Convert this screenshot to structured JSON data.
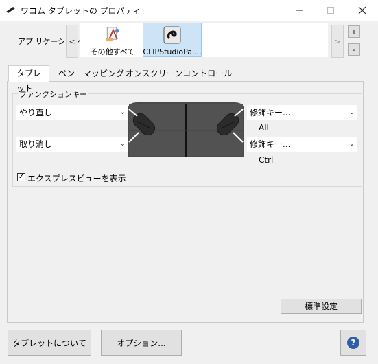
{
  "window": {
    "title": "ワコム タブレットの プロパティ",
    "minimize_glyph": "—",
    "maximize_glyph": "☐",
    "close_glyph": "✕"
  },
  "application": {
    "label": "アプ リケーション:",
    "prev": "<",
    "next": ">",
    "add": "+",
    "remove": "-",
    "items": [
      {
        "name": "その他すべて",
        "icon": "all-apps-icon",
        "selected": false
      },
      {
        "name": "CLIPStudioPai...",
        "icon": "clip-studio-icon",
        "selected": true
      }
    ]
  },
  "tabs": [
    {
      "label": "タブレット",
      "active": true
    },
    {
      "label": "ペン",
      "active": false
    },
    {
      "label": "マッピング",
      "active": false
    },
    {
      "label": "オンスクリーンコントロール",
      "active": false
    }
  ],
  "function_keys": {
    "group_title": "ファンクションキー",
    "left_top": "やり直し",
    "left_bottom": "取り消し",
    "right_top": "修飾キー...",
    "right_top_modifier": "Alt",
    "right_bottom": "修飾キー...",
    "right_bottom_modifier": "Ctrl"
  },
  "express_view": {
    "label": "エクスプレスビューを表示",
    "checked": true,
    "check_glyph": "✓"
  },
  "buttons": {
    "default": "標準設定",
    "about": "タブレットについて",
    "options": "オプション...",
    "help": "?"
  },
  "colors": {
    "selection": "#cde4f7",
    "tablet_body": "#4a4a4a",
    "help_blue": "#2f5ea8"
  }
}
